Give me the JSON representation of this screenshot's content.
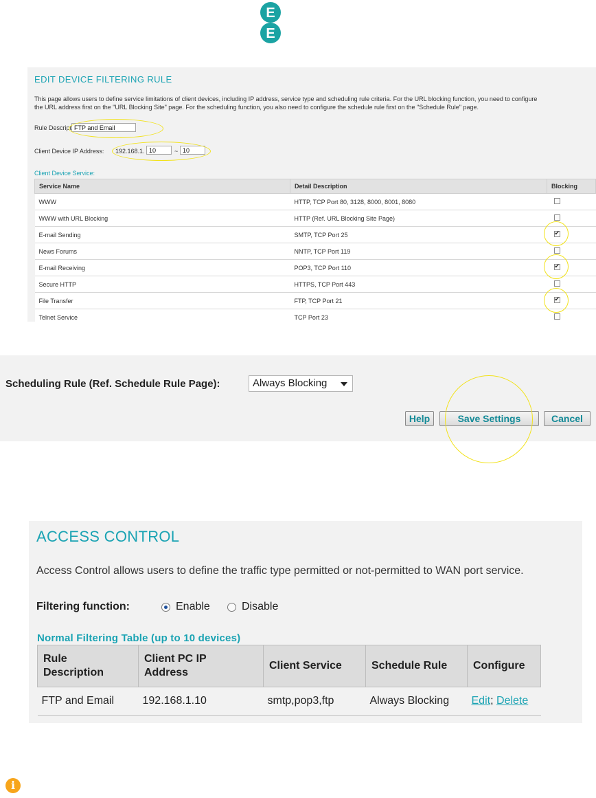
{
  "logo": {
    "letters": [
      "E",
      "E"
    ],
    "color": "#1ba3a3"
  },
  "filter_rule": {
    "title": "EDIT DEVICE FILTERING RULE",
    "description_line1": "This page allows users to define service limitations of client devices, including IP address, service type and scheduling rule criteria. For the URL blocking function, you need to configure",
    "description_line2": "the URL address first on the \"URL Blocking Site\" page. For the scheduling function, you also need to configure the schedule rule first on the \"Schedule Rule\" page.",
    "rule_description_label": "Rule Description:",
    "rule_description_value": "FTP and Email",
    "client_ip_label": "Client Device IP Address:",
    "ip_prefix": "192.168.1.",
    "ip_from": "10",
    "ip_separator": "~",
    "ip_to": "10",
    "service_heading": "Client Device Service:",
    "columns": [
      "Service Name",
      "Detail Description",
      "Blocking"
    ],
    "services": [
      {
        "name": "WWW",
        "detail": "HTTP, TCP Port 80, 3128, 8000, 8001, 8080",
        "blocked": false
      },
      {
        "name": "WWW with URL Blocking",
        "detail": "HTTP (Ref. URL Blocking Site Page)",
        "blocked": false
      },
      {
        "name": "E-mail Sending",
        "detail": "SMTP, TCP Port 25",
        "blocked": true
      },
      {
        "name": "News Forums",
        "detail": "NNTP, TCP Port 119",
        "blocked": false
      },
      {
        "name": "E-mail Receiving",
        "detail": "POP3, TCP Port 110",
        "blocked": true
      },
      {
        "name": "Secure HTTP",
        "detail": "HTTPS, TCP Port 443",
        "blocked": false
      },
      {
        "name": "File Transfer",
        "detail": "FTP, TCP Port 21",
        "blocked": true
      },
      {
        "name": "Telnet Service",
        "detail": "TCP Port 23",
        "blocked": false
      }
    ]
  },
  "scheduling": {
    "label": "Scheduling Rule (Ref. Schedule Rule Page):",
    "selected": "Always Blocking",
    "help_button": "Help",
    "save_button": "Save Settings",
    "cancel_button": "Cancel"
  },
  "access_control": {
    "title": "ACCESS CONTROL",
    "description": "Access Control allows users to define the traffic type permitted or not-permitted to WAN port service.",
    "filtering_label": "Filtering function:",
    "enable_label": "Enable",
    "disable_label": "Disable",
    "enabled": true,
    "table_title": "Normal Filtering Table (up to 10 devices)",
    "columns": [
      "Rule Description",
      "Client PC IP Address",
      "Client Service",
      "Schedule Rule",
      "Configure"
    ],
    "rows": [
      {
        "rule": "FTP and Email",
        "ip": "192.168.1.10",
        "service": "smtp,pop3,ftp",
        "schedule": "Always Blocking",
        "edit": "Edit",
        "sep": ";",
        "delete": "Delete"
      }
    ]
  },
  "info_icon": {
    "glyph": "i",
    "color": "#f7a51b"
  },
  "highlight_color": "#f2e21a"
}
